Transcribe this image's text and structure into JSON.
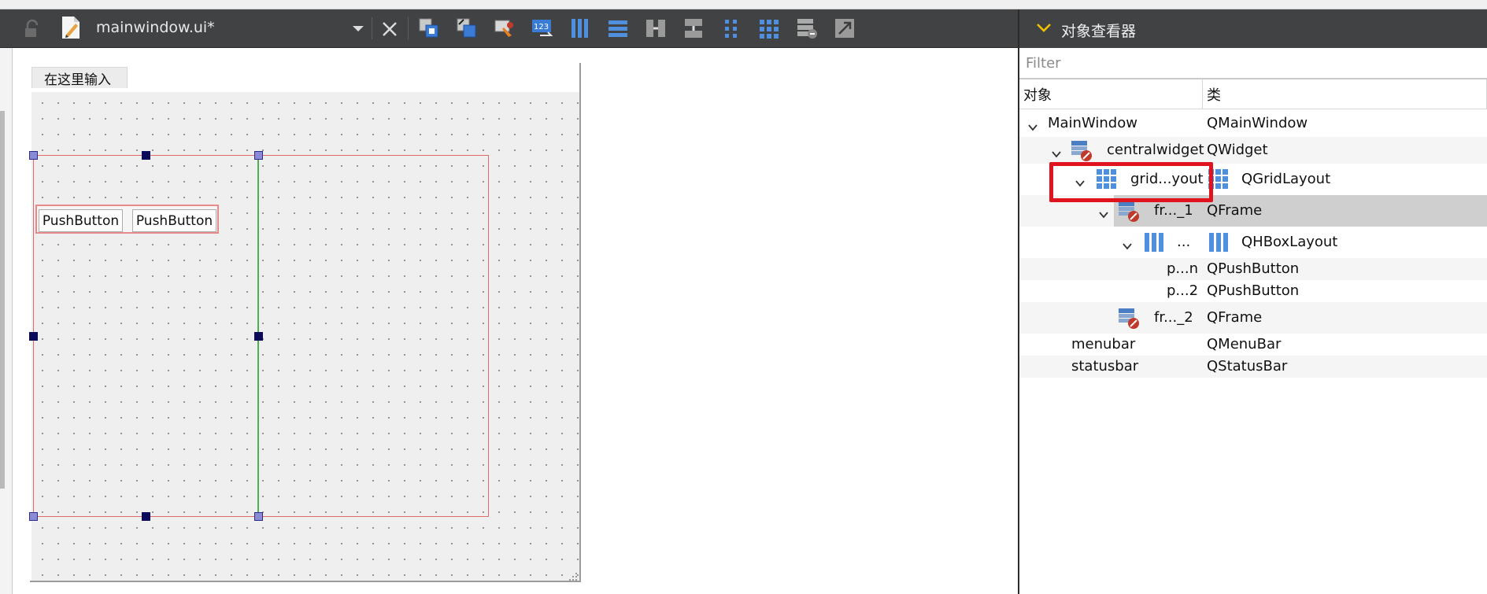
{
  "editor": {
    "document_name": "mainwindow.ui*",
    "menu_placeholder": "在这里输入",
    "buttons": [
      "PushButton",
      "PushButton"
    ],
    "toolbar_icons": [
      "add-widget-icon",
      "remove-widget-icon",
      "edit-buddies-icon",
      "tab-order-icon",
      "layout-horizontal-icon",
      "layout-vertical-icon",
      "splitter-horizontal-icon",
      "splitter-vertical-icon",
      "layout-form-icon",
      "layout-grid-icon",
      "break-layout-icon",
      "adjust-size-icon"
    ]
  },
  "inspector": {
    "title": "对象查看器",
    "filter_placeholder": "Filter",
    "col_object": "对象",
    "col_class": "类",
    "rows": [
      {
        "object": "MainWindow",
        "class": "QMainWindow"
      },
      {
        "object": "centralwidget",
        "class": "QWidget"
      },
      {
        "object": "grid...yout",
        "class": "QGridLayout"
      },
      {
        "object": "fr..._1",
        "class": "QFrame"
      },
      {
        "object": "...",
        "class": "QHBoxLayout"
      },
      {
        "object": "p...n",
        "class": "QPushButton"
      },
      {
        "object": "p...2",
        "class": "QPushButton"
      },
      {
        "object": "fr..._2",
        "class": "QFrame"
      },
      {
        "object": "menubar",
        "class": "QMenuBar"
      },
      {
        "object": "statusbar",
        "class": "QStatusBar"
      }
    ],
    "selected_row": "fr..._1",
    "highlighted_row": "grid...yout"
  },
  "colors": {
    "toolbar_bg": "#404244",
    "highlight": "#e0141e",
    "selection": "#cfcfcf",
    "layout_border": "#e06a6a",
    "splitter": "#4caf50"
  }
}
